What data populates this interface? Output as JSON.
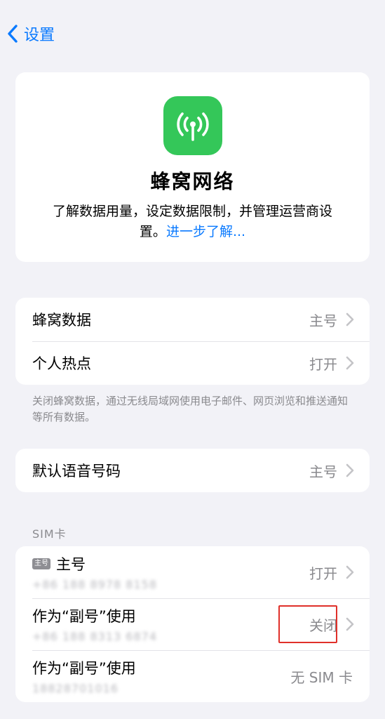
{
  "nav": {
    "back_label": "设置"
  },
  "hero": {
    "title": "蜂窝网络",
    "description": "了解数据用量，设定数据限制，并管理运营商设置。",
    "learn_more": "进一步了解..."
  },
  "group1": {
    "rows": [
      {
        "label": "蜂窝数据",
        "value": "主号"
      },
      {
        "label": "个人热点",
        "value": "打开"
      }
    ],
    "footnote": "关闭蜂窝数据，通过无线局域网使用电子邮件、网页浏览和推送通知等所有数据。"
  },
  "group2": {
    "rows": [
      {
        "label": "默认语音号码",
        "value": "主号"
      }
    ]
  },
  "sim": {
    "header": "SIM卡",
    "rows": [
      {
        "tag": "主号",
        "title": "主号",
        "number": "+86 188 8978 8158",
        "value": "打开"
      },
      {
        "title": "作为“副号”使用",
        "number": "+86 188 8313 6874",
        "value": "关闭"
      },
      {
        "title": "作为“副号”使用",
        "number": "18828701016",
        "value": "无 SIM 卡"
      }
    ]
  },
  "colors": {
    "accent": "#0a7aff",
    "app_icon": "#34c759",
    "highlight": "#e0302a"
  }
}
